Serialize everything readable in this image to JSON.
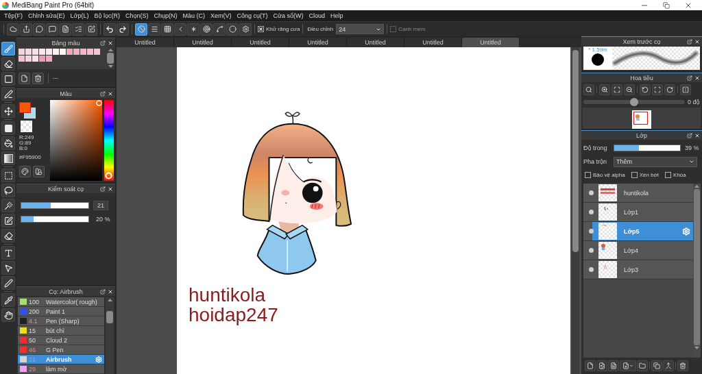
{
  "window": {
    "title": "MediBang Paint Pro (64bit)"
  },
  "menu": [
    "Tệp(F)",
    "Chỉnh sửa(E)",
    "Lớp(L)",
    "Bộ lọc(R)",
    "Chọn(S)",
    "Chụp(N)",
    "Màu (C)",
    "Xem(V)",
    "Công cụ(T)",
    "Cửa sổ(W)",
    "Cloud",
    "Help"
  ],
  "toolbar": {
    "snap_buttons": [
      {
        "selected": true
      },
      {
        "selected": false
      },
      {
        "selected": false
      },
      {
        "selected": false
      },
      {
        "selected": false
      },
      {
        "selected": false
      },
      {
        "selected": false
      },
      {
        "selected": false
      },
      {
        "selected": false
      }
    ],
    "antialias": {
      "label": "Khử răng cưa",
      "checked": true
    },
    "correction": {
      "label": "Điều chỉnh",
      "value": "24"
    },
    "soft_edge": {
      "label": "Cạnh mềm",
      "checked": false,
      "disabled": true
    }
  },
  "tools": [
    {
      "selected": true
    },
    {
      "selected": false
    },
    {
      "selected": false
    },
    {
      "selected": false
    },
    {
      "selected": false
    },
    {
      "selected": false
    },
    {
      "selected": false
    },
    {
      "selected": false
    },
    {
      "selected": false
    },
    {
      "selected": false
    },
    {
      "selected": false
    },
    {
      "selected": false
    },
    {
      "selected": false
    },
    {
      "selected": false
    },
    {
      "selected": false
    },
    {
      "selected": false
    },
    {
      "selected": false
    },
    {
      "selected": false
    }
  ],
  "palette_panel": {
    "title": "Bảng màu",
    "swatches": [
      {
        "color": "#f6d4da"
      },
      {
        "color": "#f8dae0"
      },
      {
        "color": "#f9e0e4"
      },
      {
        "color": "#fae6e8"
      },
      {
        "color": "#fce9ea"
      },
      {
        "color": "#fdf0ee"
      },
      {
        "color": "#fff6f4"
      },
      {
        "color": "#f2a8b8"
      },
      {
        "color": "#f3b0c0"
      },
      {
        "color": "#f4b6c5"
      },
      {
        "color": "#f6bccb"
      },
      {
        "color": "#f8c6d2"
      },
      {
        "color": "#f4c0cc"
      },
      {
        "color": "#f8d4da"
      },
      {
        "color": "#fae0e4"
      },
      {
        "color": "#ee9cb4"
      },
      {
        "color": "#f2aac0"
      }
    ],
    "palette_name": "---"
  },
  "color_panel": {
    "title": "Màu",
    "foreground": {
      "color": "#f95900"
    },
    "background": {
      "color": "#a8dcf0"
    },
    "rgb": [
      "R:249",
      "G:89",
      "B:0"
    ],
    "hex": "#F95900"
  },
  "brush_control": {
    "title": "Kiểm soát cọ",
    "sliders": [
      {
        "kind": "size",
        "level": 0.44,
        "reading": "21"
      },
      {
        "kind": "opacity",
        "level": 0.18,
        "reading": "20 %"
      }
    ]
  },
  "brush_panel": {
    "title": "Cọ: Airbrush",
    "brushes": [
      {
        "color": "#a8e070",
        "size": "100",
        "size_highlighted": false,
        "name": "Watercolor( rough)",
        "selected": false
      },
      {
        "color": "#3050f0",
        "size": "200",
        "size_highlighted": false,
        "name": "Paint 1",
        "selected": false
      },
      {
        "color": "#202020",
        "size": "4.1",
        "size_highlighted": true,
        "name": "Pen (Sharp)",
        "selected": false
      },
      {
        "color": "#f0dc20",
        "size": "15",
        "size_highlighted": false,
        "name": "bút chì",
        "selected": false
      },
      {
        "color": "#f03030",
        "size": "50",
        "size_highlighted": false,
        "name": "Cloud 2",
        "selected": false
      },
      {
        "color": "#f03030",
        "size": "46",
        "size_highlighted": true,
        "name": "G Pen",
        "selected": false
      },
      {
        "color": "#d4d4d4",
        "size": "21",
        "size_highlighted": true,
        "name": "Airbrush",
        "selected": true
      },
      {
        "color": "#f0a0f0",
        "size": "29",
        "size_highlighted": true,
        "name": "làm mờ",
        "selected": false
      }
    ]
  },
  "tabs": [
    {
      "label": "Untitled",
      "selected": false
    },
    {
      "label": "Untitled",
      "selected": false
    },
    {
      "label": "Untitled",
      "selected": false
    },
    {
      "label": "Untitled",
      "selected": false
    },
    {
      "label": "Untitled",
      "selected": false
    },
    {
      "label": "Untitled",
      "selected": false
    },
    {
      "label": "Untitled",
      "selected": true
    }
  ],
  "canvas": {
    "texts": [
      "huntikola",
      "hoidap247"
    ]
  },
  "brush_preview": {
    "title": "Xem trước cọ",
    "size": "* 1.59m"
  },
  "navigator": {
    "title": "Hoa tiêu",
    "rotation": {
      "level": 0.5,
      "reading": "0 độ"
    }
  },
  "layers_panel": {
    "title": "Lớp",
    "opacity": {
      "label": "Độ trong",
      "level": 0.38,
      "reading": "39 %"
    },
    "blend": {
      "label": "Pha trộn",
      "value": "Thêm"
    },
    "options": [
      {
        "label": "Bảo vệ alpha",
        "checked": false
      },
      {
        "label": "Xén bớt",
        "checked": false
      },
      {
        "label": "Khóa",
        "checked": false
      }
    ],
    "layers": [
      {
        "name": "huntikola",
        "visible": true,
        "selected": false
      },
      {
        "name": "Lớp1",
        "visible": true,
        "selected": false
      },
      {
        "name": "Lớp5",
        "visible": true,
        "selected": true
      },
      {
        "name": "Lớp4",
        "visible": true,
        "selected": false
      },
      {
        "name": "Lớp3",
        "visible": true,
        "selected": false
      }
    ]
  }
}
